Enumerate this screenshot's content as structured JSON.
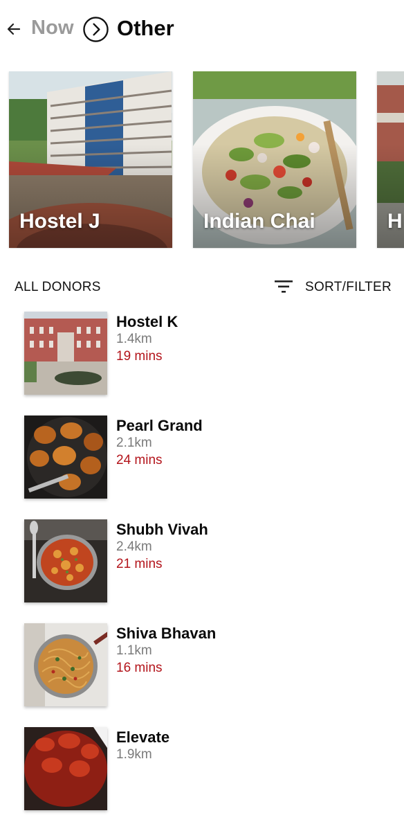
{
  "header": {
    "back_icon": "arrow-left-icon",
    "crumb_previous": "Now",
    "separator_icon": "chevron-right-circle-icon",
    "crumb_current": "Other"
  },
  "featured": [
    {
      "title": "Hostel J",
      "image": "building-photo"
    },
    {
      "title": "Indian Chai",
      "image": "salad-photo"
    },
    {
      "title": "H",
      "image": "building-photo"
    }
  ],
  "section": {
    "title": "ALL DONORS",
    "filter_icon": "filter-lines-icon",
    "sort_filter_label": "SORT/FILTER"
  },
  "donors": [
    {
      "name": "Hostel K",
      "distance": "1.4km",
      "time": "19 mins",
      "image": "building-photo"
    },
    {
      "name": "Pearl Grand",
      "distance": "2.1km",
      "time": "24 mins",
      "image": "roast-chicken-photo"
    },
    {
      "name": "Shubh Vivah",
      "distance": "2.4km",
      "time": "21 mins",
      "image": "curry-pan-photo"
    },
    {
      "name": "Shiva Bhavan",
      "distance": "1.1km",
      "time": "16 mins",
      "image": "noodles-pan-photo"
    },
    {
      "name": "Elevate",
      "distance": "1.9km",
      "time": "",
      "image": "red-chicken-photo"
    }
  ],
  "colors": {
    "accent_time": "#b3141b",
    "muted_crumb": "#9a9a9a"
  }
}
